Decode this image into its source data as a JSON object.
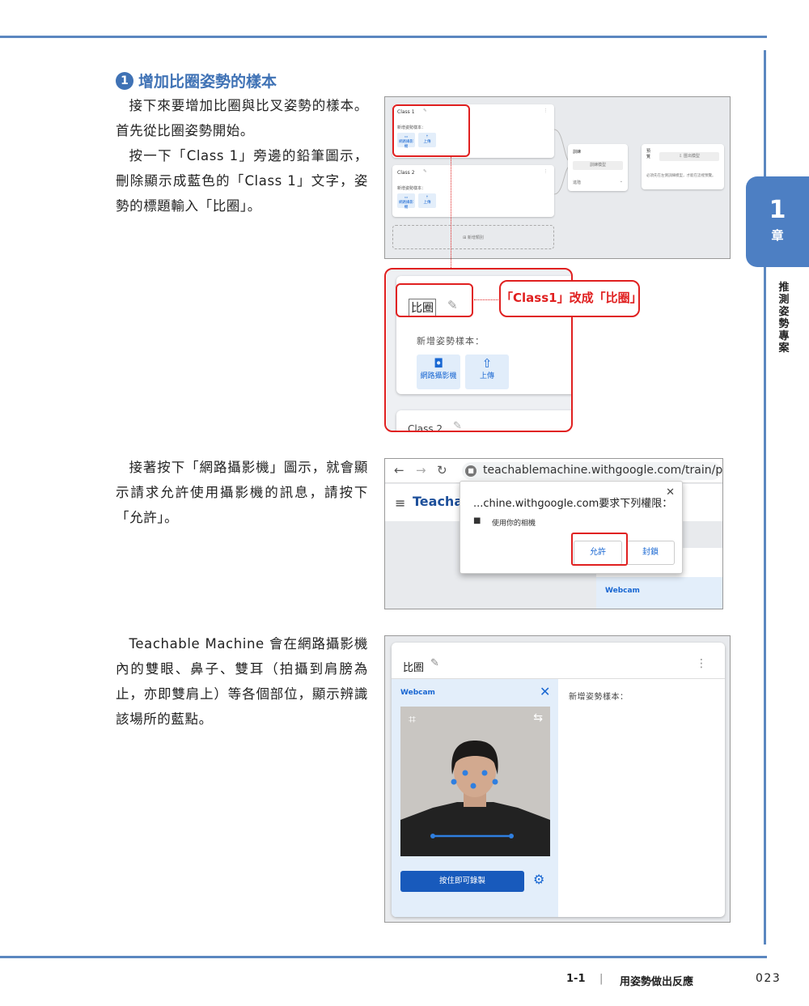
{
  "chapter": {
    "number": "1",
    "word": "章",
    "side_title": "推測姿勢專案"
  },
  "step": {
    "number": "1",
    "heading": "增加比圈姿勢的樣本"
  },
  "paragraphs": {
    "p1": "接下來要增加比圈與比叉姿勢的樣本。首先從比圈姿勢開始。",
    "p2": "按一下「Class 1」旁邊的鉛筆圖示，刪除顯示成藍色的「Class 1」文字，姿勢的標題輸入「比圈」。",
    "p3": "接著按下「網路攝影機」圖示，就會顯示請求允許使用攝影機的訊息，請按下「允許」。",
    "p4": "Teachable Machine 會在網路攝影機內的雙眼、鼻子、雙耳（拍攝到肩膀為止，亦即雙肩上）等各個部位，顯示辨識該場所的藍點。"
  },
  "shot1": {
    "class1": "Class 1",
    "class2": "Class 2",
    "add_samples": "新增姿勢樣本：",
    "webcam": "網路攝影機",
    "upload": "上傳",
    "add_class": "⊞ 新增類別",
    "train": "訓練",
    "train_btn": "訓練模型",
    "advanced": "進階",
    "preview": "預覽",
    "export": "匯出模型",
    "preview_note": "必須先在左側訓練模型，才能在這裡預覽。"
  },
  "zoom": {
    "title": "比圈",
    "add_samples": "新增姿勢樣本：",
    "webcam": "網路攝影機",
    "upload": "上傳",
    "class2": "Class 2",
    "callout": "「Class1」改成「比圈」"
  },
  "shot2": {
    "url": "teachablemachine.withgoogle.com/train/pose",
    "logo": "Teachab",
    "dialog_title": "...chine.withgoogle.com要求下列權限：",
    "permission": "使用你的相機",
    "allow": "允許",
    "block": "封鎖",
    "webcam": "Webcam"
  },
  "shot3": {
    "title": "比圈",
    "webcam": "Webcam",
    "hold_to_record": "按住即可錄製",
    "add_samples": "新增姿勢樣本："
  },
  "footer": {
    "section": "1-1",
    "separator": "|",
    "title": "用姿勢做出反應",
    "page": "023"
  },
  "colors": {
    "accent_blue": "#4d7fc3",
    "highlight_red": "#e02020",
    "tm_blue": "#1967d2"
  }
}
